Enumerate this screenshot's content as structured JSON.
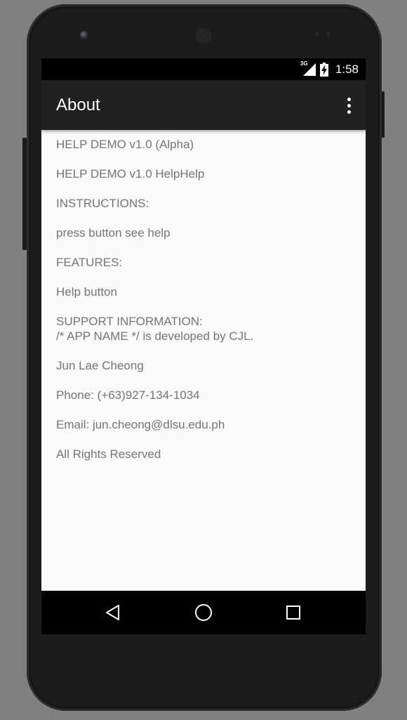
{
  "status_bar": {
    "network_type": "3G",
    "time": "1:58"
  },
  "app_bar": {
    "title": "About",
    "overflow_icon": "more-vert-icon"
  },
  "content": {
    "lines": [
      "HELP DEMO v1.0 (Alpha)",
      "HELP DEMO v1.0 HelpHelp",
      "INSTRUCTIONS:",
      "press button see help",
      "FEATURES:",
      "Help button",
      "SUPPORT INFORMATION:\n/* APP NAME */ is developed by CJL.",
      "Jun Lae Cheong",
      "Phone: (+63)927-134-1034",
      "Email: jun.cheong@dlsu.edu.ph",
      "All Rights Reserved"
    ]
  },
  "nav_bar": {
    "back_icon": "back-triangle-icon",
    "home_icon": "home-circle-icon",
    "recents_icon": "recents-square-icon"
  },
  "colors": {
    "app_bar": "#212121",
    "status_bar": "#000000",
    "screen_background": "#fafafa",
    "body_text": "#757575",
    "device_frame": "#1c1c1c",
    "backdrop": "#808080"
  }
}
